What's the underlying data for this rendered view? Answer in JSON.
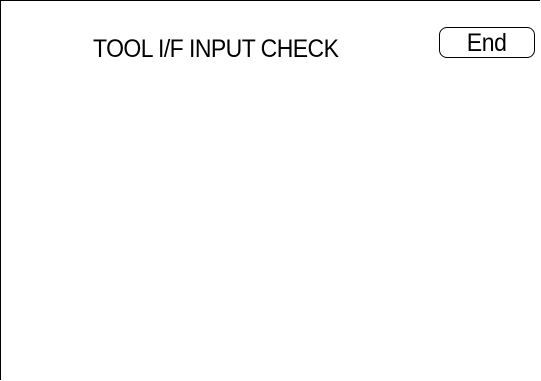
{
  "header": {
    "title": "TOOL I/F INPUT CHECK",
    "end_button_label": "End"
  },
  "colors": {
    "background": "#ffffff",
    "foreground": "#000000"
  }
}
